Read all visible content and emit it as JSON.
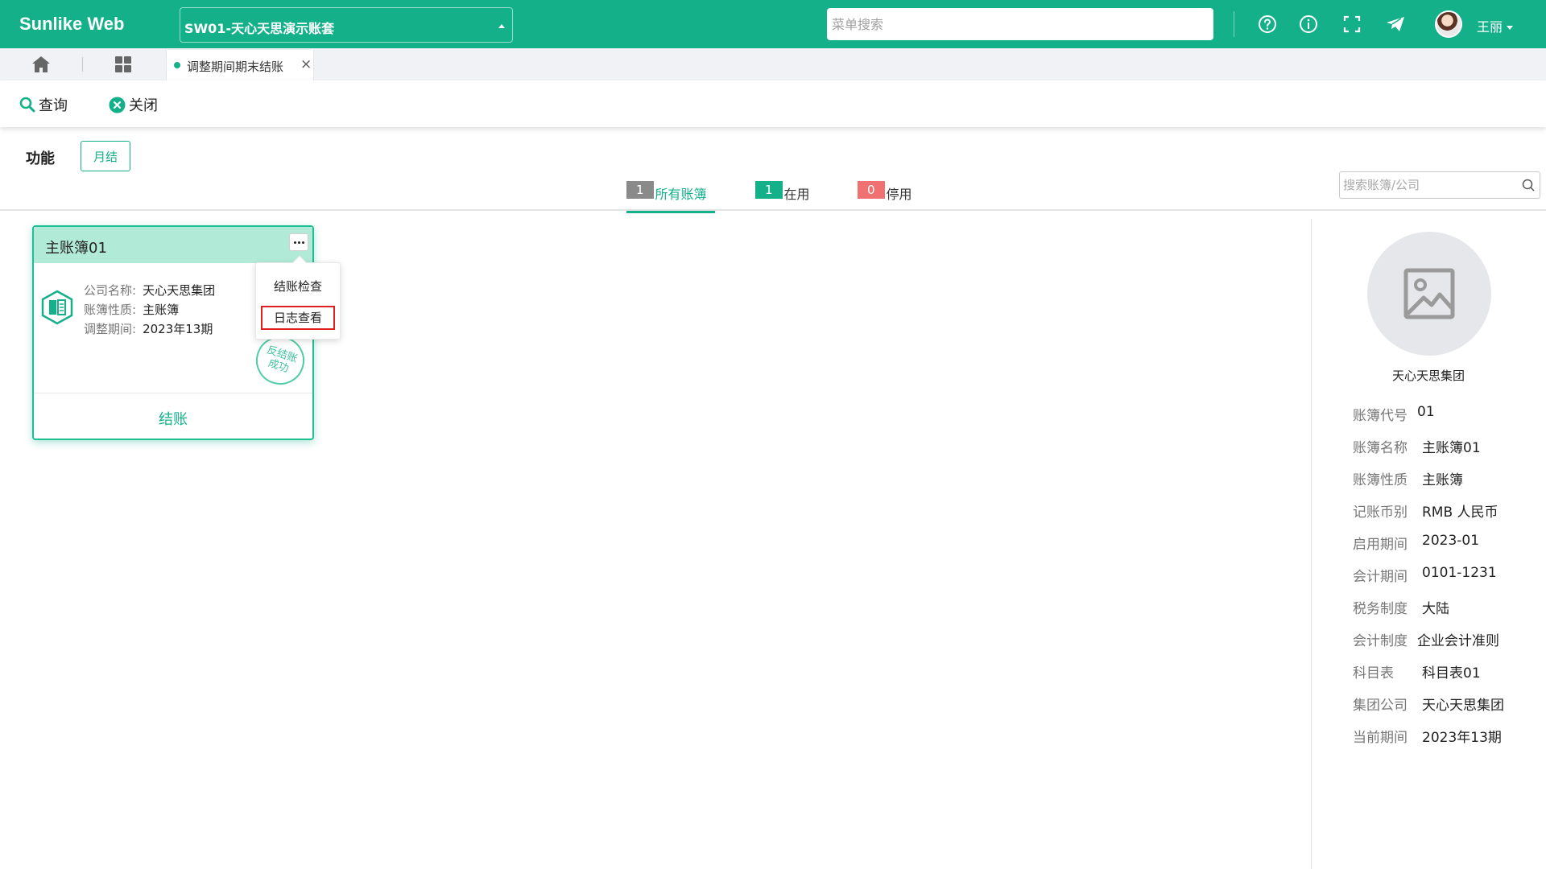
{
  "app": {
    "brand": "Sunlike Web",
    "account_set": "SW01-天心天思演示账套",
    "menu_search_placeholder": "菜单搜索",
    "user_name": "王丽"
  },
  "tabs": {
    "active_label": "调整期间期末结账",
    "close_glyph": "×"
  },
  "toolbar": {
    "query_label": "查询",
    "close_label": "关闭"
  },
  "function": {
    "label": "功能",
    "month_end_button": "月结"
  },
  "filters": [
    {
      "count": "1",
      "label": "所有账簿",
      "color": "#8a8a8a",
      "active": true
    },
    {
      "count": "1",
      "label": "在用",
      "color": "#14b08a",
      "active": false
    },
    {
      "count": "0",
      "label": "停用",
      "color": "#f07171",
      "active": false
    }
  ],
  "book_search_placeholder": "搜索账簿/公司",
  "card": {
    "title": "主账簿01",
    "fields": [
      {
        "label": "公司名称:",
        "value": "天心天思集团"
      },
      {
        "label": "账簿性质:",
        "value": "主账簿"
      },
      {
        "label": "调整期间:",
        "value": "2023年13期"
      }
    ],
    "stamp_line1": "反结账",
    "stamp_line2": "成功",
    "action_label": "结账"
  },
  "popup_menu": {
    "items": [
      "结账检查",
      "日志查看"
    ],
    "highlighted": "日志查看"
  },
  "detail": {
    "company": "天心天思集团",
    "properties": [
      {
        "label": "账簿代号",
        "value": "01"
      },
      {
        "label": "账簿名称",
        "value": "主账簿01"
      },
      {
        "label": "账簿性质",
        "value": "主账簿"
      },
      {
        "label": "记账币别",
        "value": "RMB 人民币"
      },
      {
        "label": "启用期间",
        "value": "2023-01"
      },
      {
        "label": "会计期间",
        "value": "0101-1231"
      },
      {
        "label": "税务制度",
        "value": "大陆"
      },
      {
        "label": "会计制度",
        "value": "企业会计准则"
      },
      {
        "label": "科目表",
        "value": "科目表01"
      },
      {
        "label": "集团公司",
        "value": "天心天思集团"
      },
      {
        "label": "当前期间",
        "value": "2023年13期"
      }
    ]
  },
  "colors": {
    "primary": "#14b08a",
    "highlight_border": "#e02020"
  },
  "icons": [
    "help-icon",
    "info-icon",
    "fullscreen-icon",
    "plane-icon",
    "home-icon",
    "grid-icon",
    "search-icon",
    "close-circle-icon",
    "book-icon",
    "image-placeholder-icon"
  ]
}
